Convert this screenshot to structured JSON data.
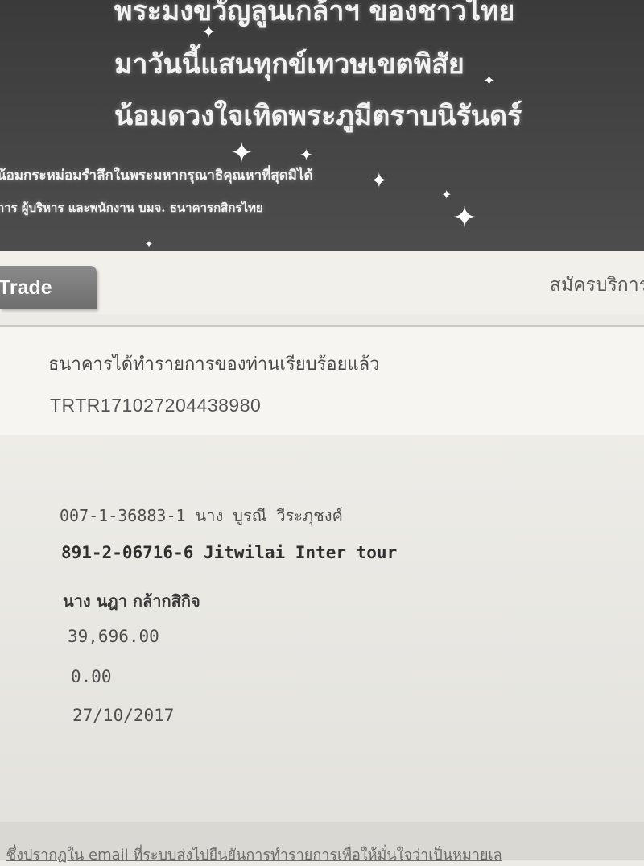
{
  "banner": {
    "line1": "พระมงขวัญลูนเกล้าฯ ของชาวไทย",
    "line2": "มาวันนี้แสนทุกข์เทวษเขตพิสัย",
    "line3": "น้อมดวงใจเทิดพระภูมีตราบนิรันดร์",
    "line4": "น้อมกระหม่อมรำลึกในพระมหากรุณาธิคุณหาที่สุดมิได้",
    "line5": "การ ผู้บริหาร และพนักงาน บมจ. ธนาคารกสิกรไทย"
  },
  "tabs": {
    "trade": "Trade",
    "register": "สมัครบริการ"
  },
  "result": {
    "message": "ธนาคารได้ทำรายการของท่านเรียบร้อยแล้ว",
    "reference": "TRTR171027204438980"
  },
  "transaction": {
    "from_account": "007-1-36883-1 นาง บูรณี วีระภุชงค์",
    "to_account": "891-2-06716-6 Jitwilai Inter tour",
    "to_name": "นาง นฎา กล้ากสิกิจ",
    "amount": "39,696.00",
    "fee": "0.00",
    "date": "27/10/2017"
  },
  "footer": {
    "note": "ซึ่งปรากฏใน email ที่ระบบส่งไปยืนยันการทำรายการเพื่อให้มั่นใจว่าเป็นหมายเล"
  }
}
